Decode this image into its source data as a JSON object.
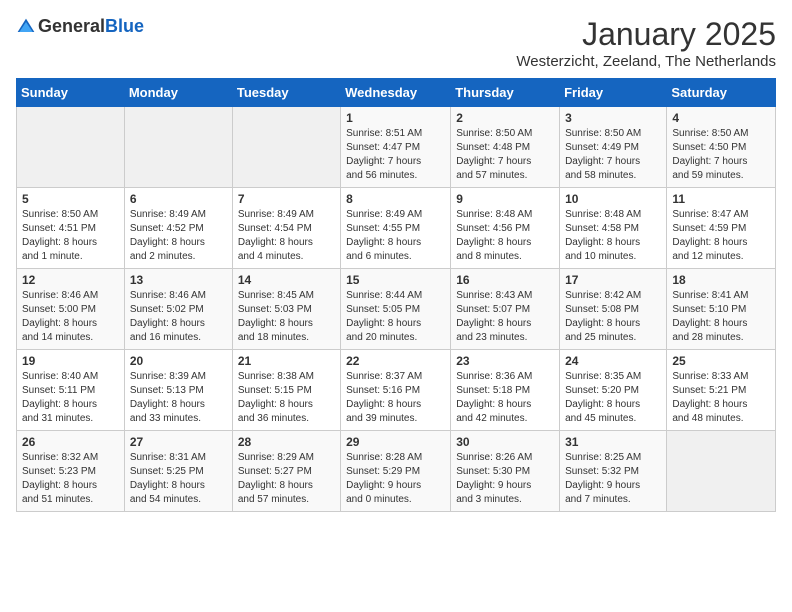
{
  "header": {
    "logo_general": "General",
    "logo_blue": "Blue",
    "month": "January 2025",
    "location": "Westerzicht, Zeeland, The Netherlands"
  },
  "weekdays": [
    "Sunday",
    "Monday",
    "Tuesday",
    "Wednesday",
    "Thursday",
    "Friday",
    "Saturday"
  ],
  "weeks": [
    [
      {
        "day": "",
        "info": ""
      },
      {
        "day": "",
        "info": ""
      },
      {
        "day": "",
        "info": ""
      },
      {
        "day": "1",
        "info": "Sunrise: 8:51 AM\nSunset: 4:47 PM\nDaylight: 7 hours\nand 56 minutes."
      },
      {
        "day": "2",
        "info": "Sunrise: 8:50 AM\nSunset: 4:48 PM\nDaylight: 7 hours\nand 57 minutes."
      },
      {
        "day": "3",
        "info": "Sunrise: 8:50 AM\nSunset: 4:49 PM\nDaylight: 7 hours\nand 58 minutes."
      },
      {
        "day": "4",
        "info": "Sunrise: 8:50 AM\nSunset: 4:50 PM\nDaylight: 7 hours\nand 59 minutes."
      }
    ],
    [
      {
        "day": "5",
        "info": "Sunrise: 8:50 AM\nSunset: 4:51 PM\nDaylight: 8 hours\nand 1 minute."
      },
      {
        "day": "6",
        "info": "Sunrise: 8:49 AM\nSunset: 4:52 PM\nDaylight: 8 hours\nand 2 minutes."
      },
      {
        "day": "7",
        "info": "Sunrise: 8:49 AM\nSunset: 4:54 PM\nDaylight: 8 hours\nand 4 minutes."
      },
      {
        "day": "8",
        "info": "Sunrise: 8:49 AM\nSunset: 4:55 PM\nDaylight: 8 hours\nand 6 minutes."
      },
      {
        "day": "9",
        "info": "Sunrise: 8:48 AM\nSunset: 4:56 PM\nDaylight: 8 hours\nand 8 minutes."
      },
      {
        "day": "10",
        "info": "Sunrise: 8:48 AM\nSunset: 4:58 PM\nDaylight: 8 hours\nand 10 minutes."
      },
      {
        "day": "11",
        "info": "Sunrise: 8:47 AM\nSunset: 4:59 PM\nDaylight: 8 hours\nand 12 minutes."
      }
    ],
    [
      {
        "day": "12",
        "info": "Sunrise: 8:46 AM\nSunset: 5:00 PM\nDaylight: 8 hours\nand 14 minutes."
      },
      {
        "day": "13",
        "info": "Sunrise: 8:46 AM\nSunset: 5:02 PM\nDaylight: 8 hours\nand 16 minutes."
      },
      {
        "day": "14",
        "info": "Sunrise: 8:45 AM\nSunset: 5:03 PM\nDaylight: 8 hours\nand 18 minutes."
      },
      {
        "day": "15",
        "info": "Sunrise: 8:44 AM\nSunset: 5:05 PM\nDaylight: 8 hours\nand 20 minutes."
      },
      {
        "day": "16",
        "info": "Sunrise: 8:43 AM\nSunset: 5:07 PM\nDaylight: 8 hours\nand 23 minutes."
      },
      {
        "day": "17",
        "info": "Sunrise: 8:42 AM\nSunset: 5:08 PM\nDaylight: 8 hours\nand 25 minutes."
      },
      {
        "day": "18",
        "info": "Sunrise: 8:41 AM\nSunset: 5:10 PM\nDaylight: 8 hours\nand 28 minutes."
      }
    ],
    [
      {
        "day": "19",
        "info": "Sunrise: 8:40 AM\nSunset: 5:11 PM\nDaylight: 8 hours\nand 31 minutes."
      },
      {
        "day": "20",
        "info": "Sunrise: 8:39 AM\nSunset: 5:13 PM\nDaylight: 8 hours\nand 33 minutes."
      },
      {
        "day": "21",
        "info": "Sunrise: 8:38 AM\nSunset: 5:15 PM\nDaylight: 8 hours\nand 36 minutes."
      },
      {
        "day": "22",
        "info": "Sunrise: 8:37 AM\nSunset: 5:16 PM\nDaylight: 8 hours\nand 39 minutes."
      },
      {
        "day": "23",
        "info": "Sunrise: 8:36 AM\nSunset: 5:18 PM\nDaylight: 8 hours\nand 42 minutes."
      },
      {
        "day": "24",
        "info": "Sunrise: 8:35 AM\nSunset: 5:20 PM\nDaylight: 8 hours\nand 45 minutes."
      },
      {
        "day": "25",
        "info": "Sunrise: 8:33 AM\nSunset: 5:21 PM\nDaylight: 8 hours\nand 48 minutes."
      }
    ],
    [
      {
        "day": "26",
        "info": "Sunrise: 8:32 AM\nSunset: 5:23 PM\nDaylight: 8 hours\nand 51 minutes."
      },
      {
        "day": "27",
        "info": "Sunrise: 8:31 AM\nSunset: 5:25 PM\nDaylight: 8 hours\nand 54 minutes."
      },
      {
        "day": "28",
        "info": "Sunrise: 8:29 AM\nSunset: 5:27 PM\nDaylight: 8 hours\nand 57 minutes."
      },
      {
        "day": "29",
        "info": "Sunrise: 8:28 AM\nSunset: 5:29 PM\nDaylight: 9 hours\nand 0 minutes."
      },
      {
        "day": "30",
        "info": "Sunrise: 8:26 AM\nSunset: 5:30 PM\nDaylight: 9 hours\nand 3 minutes."
      },
      {
        "day": "31",
        "info": "Sunrise: 8:25 AM\nSunset: 5:32 PM\nDaylight: 9 hours\nand 7 minutes."
      },
      {
        "day": "",
        "info": ""
      }
    ]
  ]
}
